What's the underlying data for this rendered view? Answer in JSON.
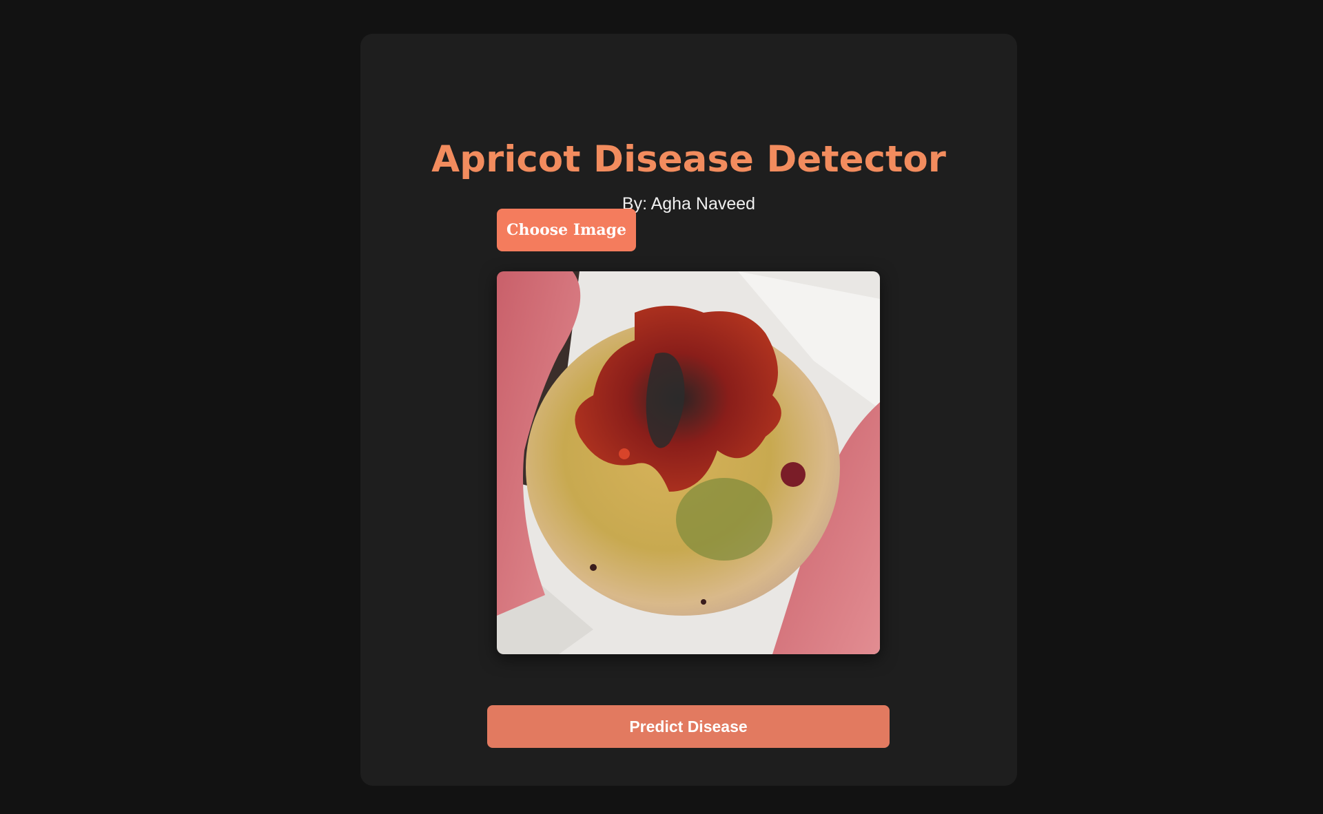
{
  "app": {
    "title": "Apricot Disease Detector",
    "subtitle": "By: Agha Naveed"
  },
  "upload": {
    "choose_label": "Choose Image"
  },
  "preview": {
    "alt": "uploaded apricot image"
  },
  "actions": {
    "predict_label": "Predict Disease"
  },
  "colors": {
    "page_background": "#121212",
    "card_background": "#1e1e1e",
    "title": "#f28c5e",
    "button_primary": "#f47c5d",
    "button_predict": "#e27a60"
  }
}
